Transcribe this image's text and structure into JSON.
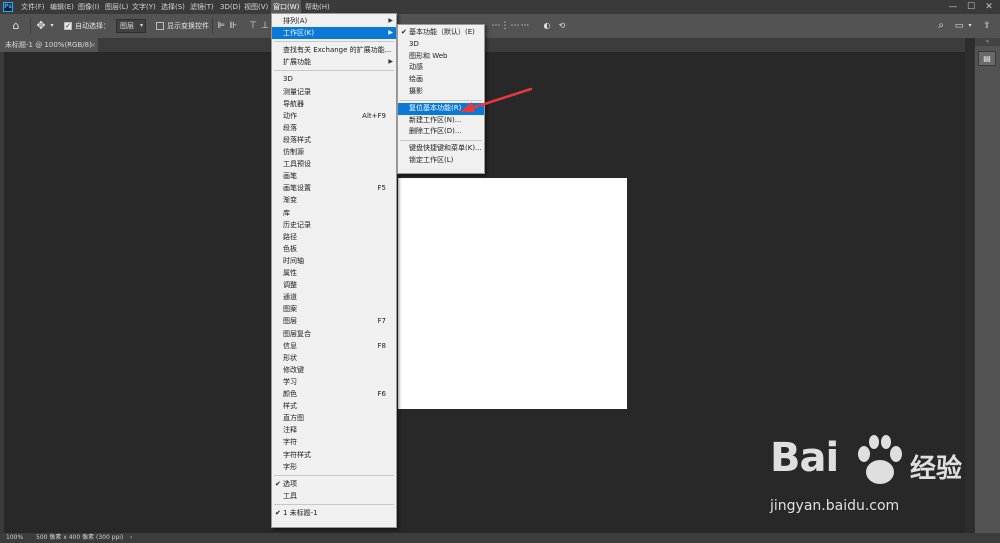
{
  "app": {
    "logo_text": "Ps"
  },
  "menubar": {
    "items": [
      "文件(F)",
      "编辑(E)",
      "图像(I)",
      "图层(L)",
      "文字(Y)",
      "选择(S)",
      "滤镜(T)",
      "3D(D)",
      "视图(V)",
      "窗口(W)",
      "帮助(H)"
    ],
    "active": "窗口(W)",
    "window_controls": [
      "—",
      "☐",
      "✕"
    ]
  },
  "options_bar": {
    "auto_select_label": "自动选择：",
    "auto_select_checked": true,
    "auto_select_value": "图层",
    "show_transform_label": "显示变换控件",
    "show_transform_checked": false
  },
  "document": {
    "tab_label": "未标题-1 @ 100%(RGB/8)",
    "tab_close": "×"
  },
  "window_menu": {
    "items": [
      {
        "label": "排列(A)",
        "submenu": true
      },
      {
        "label": "工作区(K)",
        "submenu": true,
        "highlight": true
      },
      {
        "sep": true
      },
      {
        "label": "查找有关 Exchange 的扩展功能..."
      },
      {
        "label": "扩展功能",
        "submenu": true
      },
      {
        "sep": true
      },
      {
        "label": "3D"
      },
      {
        "label": "测量记录"
      },
      {
        "label": "导航器"
      },
      {
        "label": "动作",
        "shortcut": "Alt+F9"
      },
      {
        "label": "段落"
      },
      {
        "label": "段落样式"
      },
      {
        "label": "仿制源"
      },
      {
        "label": "工具预设"
      },
      {
        "label": "画笔"
      },
      {
        "label": "画笔设置",
        "shortcut": "F5"
      },
      {
        "label": "渐变"
      },
      {
        "label": "库"
      },
      {
        "label": "历史记录"
      },
      {
        "label": "路径"
      },
      {
        "label": "色板"
      },
      {
        "label": "时间轴"
      },
      {
        "label": "属性"
      },
      {
        "label": "调整"
      },
      {
        "label": "通道"
      },
      {
        "label": "图案"
      },
      {
        "label": "图层",
        "shortcut": "F7"
      },
      {
        "label": "图层复合"
      },
      {
        "label": "信息",
        "shortcut": "F8"
      },
      {
        "label": "形状"
      },
      {
        "label": "修改键"
      },
      {
        "label": "学习"
      },
      {
        "label": "颜色",
        "shortcut": "F6"
      },
      {
        "label": "样式"
      },
      {
        "label": "直方图"
      },
      {
        "label": "注释"
      },
      {
        "label": "字符"
      },
      {
        "label": "字符样式"
      },
      {
        "label": "字形"
      },
      {
        "sep": true
      },
      {
        "label": "选项",
        "checked": true
      },
      {
        "label": "工具"
      },
      {
        "sep": true
      },
      {
        "label": "1 未标题-1",
        "checked": true
      }
    ]
  },
  "workspace_submenu": {
    "items": [
      {
        "label": "基本功能（默认）(E)",
        "checked": true
      },
      {
        "label": "3D"
      },
      {
        "label": "图形和 Web"
      },
      {
        "label": "动感"
      },
      {
        "label": "绘画"
      },
      {
        "label": "摄影"
      },
      {
        "sep": true
      },
      {
        "label": "复位基本功能(R)",
        "highlight": true
      },
      {
        "label": "新建工作区(N)..."
      },
      {
        "label": "删除工作区(D)..."
      },
      {
        "sep": true
      },
      {
        "label": "键盘快捷键和菜单(K)..."
      },
      {
        "label": "锁定工作区(L)"
      }
    ]
  },
  "status_bar": {
    "zoom": "100%",
    "doc_info": "500 像素 x 400 像素 (300 ppi)",
    "arrow": "›"
  },
  "watermark": {
    "brand": "Bai",
    "brand2": "经验",
    "url": "jingyan.baidu.com"
  },
  "colors": {
    "menu_highlight": "#0a78d7",
    "annotation_arrow": "#e8393a",
    "ps_blue": "#31a8ff"
  }
}
